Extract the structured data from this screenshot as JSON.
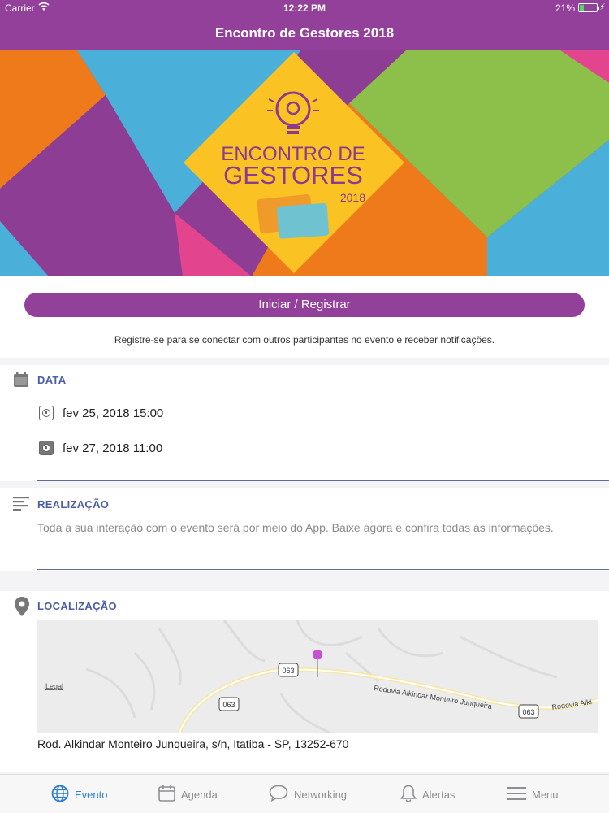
{
  "status_bar": {
    "carrier": "Carrier",
    "time": "12:22 PM",
    "battery": "21%"
  },
  "nav": {
    "title": "Encontro de Gestores 2018"
  },
  "banner": {
    "line1": "ENCONTRO DE",
    "line2": "GESTORES",
    "year": "2018",
    "colors": {
      "purple": "#8e3d94",
      "orange": "#ee7a1c",
      "blue": "#4ab0d9",
      "green": "#8dbf4b",
      "yellow": "#fbc223",
      "pink": "#e2448d",
      "text_purple": "#8a3b8f"
    }
  },
  "register": {
    "button_label": "Iniciar / Registrar",
    "hint": "Registre-se para se conectar com outros participantes no evento e receber notificações."
  },
  "data_section": {
    "title": "DATA",
    "icon": "calendar-icon",
    "dates": [
      {
        "icon": "clock-icon",
        "text": "fev 25, 2018 15:00"
      },
      {
        "icon": "clock-filled-icon",
        "text": "fev 27, 2018 11:00"
      }
    ]
  },
  "realizacao": {
    "title": "REALIZAÇÃO",
    "icon": "text-lines-icon",
    "text": "Toda a sua interação com o evento será por meio do App. Baixe agora e confira todas às  informações."
  },
  "localizacao": {
    "title": "LOCALIZAÇÃO",
    "icon": "location-pin-icon",
    "map": {
      "legal": "Legal",
      "road_badges": [
        "063",
        "063",
        "063"
      ],
      "road_name": "Rodovia Alkindar Monteiro Junqueira",
      "road_name_right": "Rodovia Alki"
    },
    "address": "Rod. Alkindar Monteiro Junqueira, s/n, Itatiba - SP, 13252-670"
  },
  "tabs": [
    {
      "label": "Evento",
      "icon": "globe-icon",
      "active": true
    },
    {
      "label": "Agenda",
      "icon": "calendar-icon",
      "active": false
    },
    {
      "label": "Networking",
      "icon": "chat-bubble-icon",
      "active": false
    },
    {
      "label": "Alertas",
      "icon": "bell-icon",
      "active": false
    },
    {
      "label": "Menu",
      "icon": "hamburger-icon",
      "active": false
    }
  ],
  "colors": {
    "brand": "#93409a",
    "accent_blue": "#4b5fa8",
    "tab_active": "#2f7fd3"
  }
}
